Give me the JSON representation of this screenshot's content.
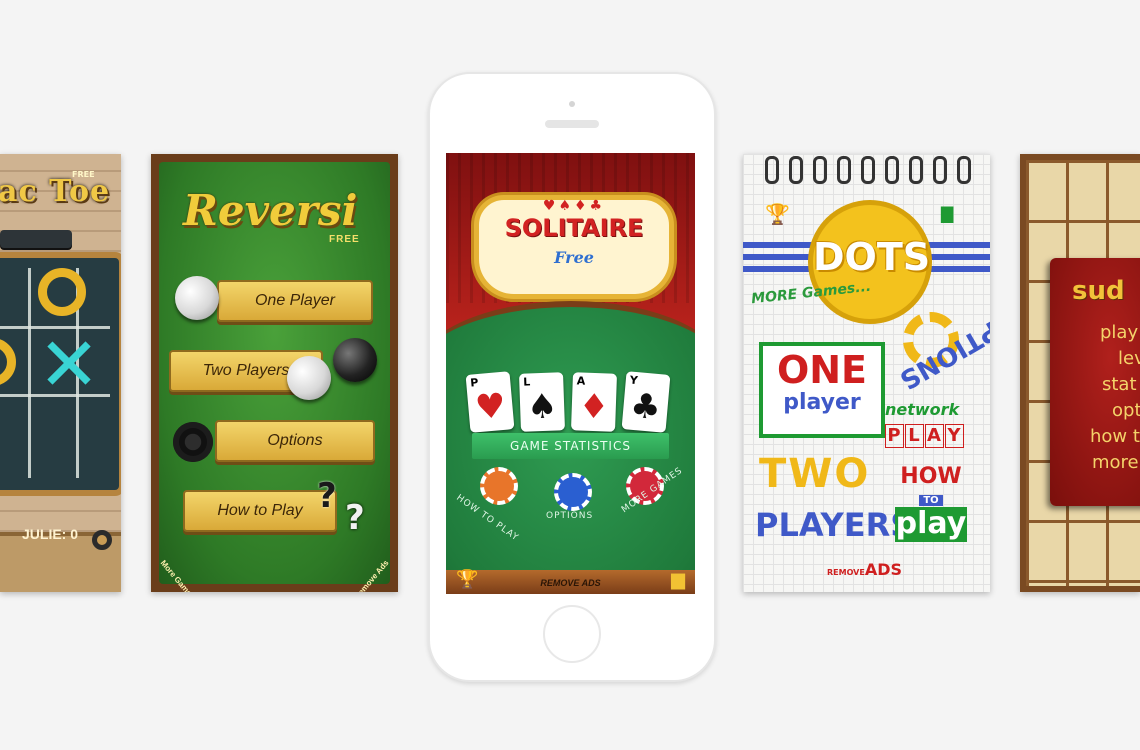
{
  "tictactoe": {
    "title": "ac Toe",
    "free": "FREE",
    "score": "JULIE: 0"
  },
  "reversi": {
    "title": "Reversi",
    "free": "FREE",
    "buttons": [
      "One Player",
      "Two Players",
      "Options",
      "How to Play"
    ],
    "more_games": "More Games",
    "remove_ads": "Remove Ads"
  },
  "solitaire": {
    "title": "SOLITAIRE",
    "free": "Free",
    "suits": "♥♠♦♣",
    "cards": [
      {
        "letter": "P",
        "suit": "♥",
        "color": "#d22222"
      },
      {
        "letter": "L",
        "suit": "♠",
        "color": "#111111"
      },
      {
        "letter": "A",
        "suit": "♦",
        "color": "#d22222"
      },
      {
        "letter": "Y",
        "suit": "♣",
        "color": "#111111"
      }
    ],
    "game_statistics": "GAME STATISTICS",
    "how_to_play": "HOW TO PLAY",
    "options": "OPTIONS",
    "more_games": "MORE GAMES",
    "remove_ads": "REMOVE ADS",
    "chip_colors": [
      "#e8752a",
      "#2a5fd1",
      "#d2283a"
    ]
  },
  "dots": {
    "title": "DOTS",
    "more_games": "MORE Games...",
    "options": "OPTIONS",
    "one": "ONE",
    "one_player": "player",
    "network": "network",
    "play_letters": [
      "P",
      "L",
      "A",
      "Y"
    ],
    "two": "TWO",
    "players": "PLAYERS",
    "how": "HOW",
    "to": "TO",
    "play": "play",
    "remove": "REMOVE",
    "ads": "ADS"
  },
  "sudoku": {
    "title": "sud",
    "items": [
      "play",
      "lev",
      "stat",
      "opt",
      "how t",
      "more"
    ]
  }
}
